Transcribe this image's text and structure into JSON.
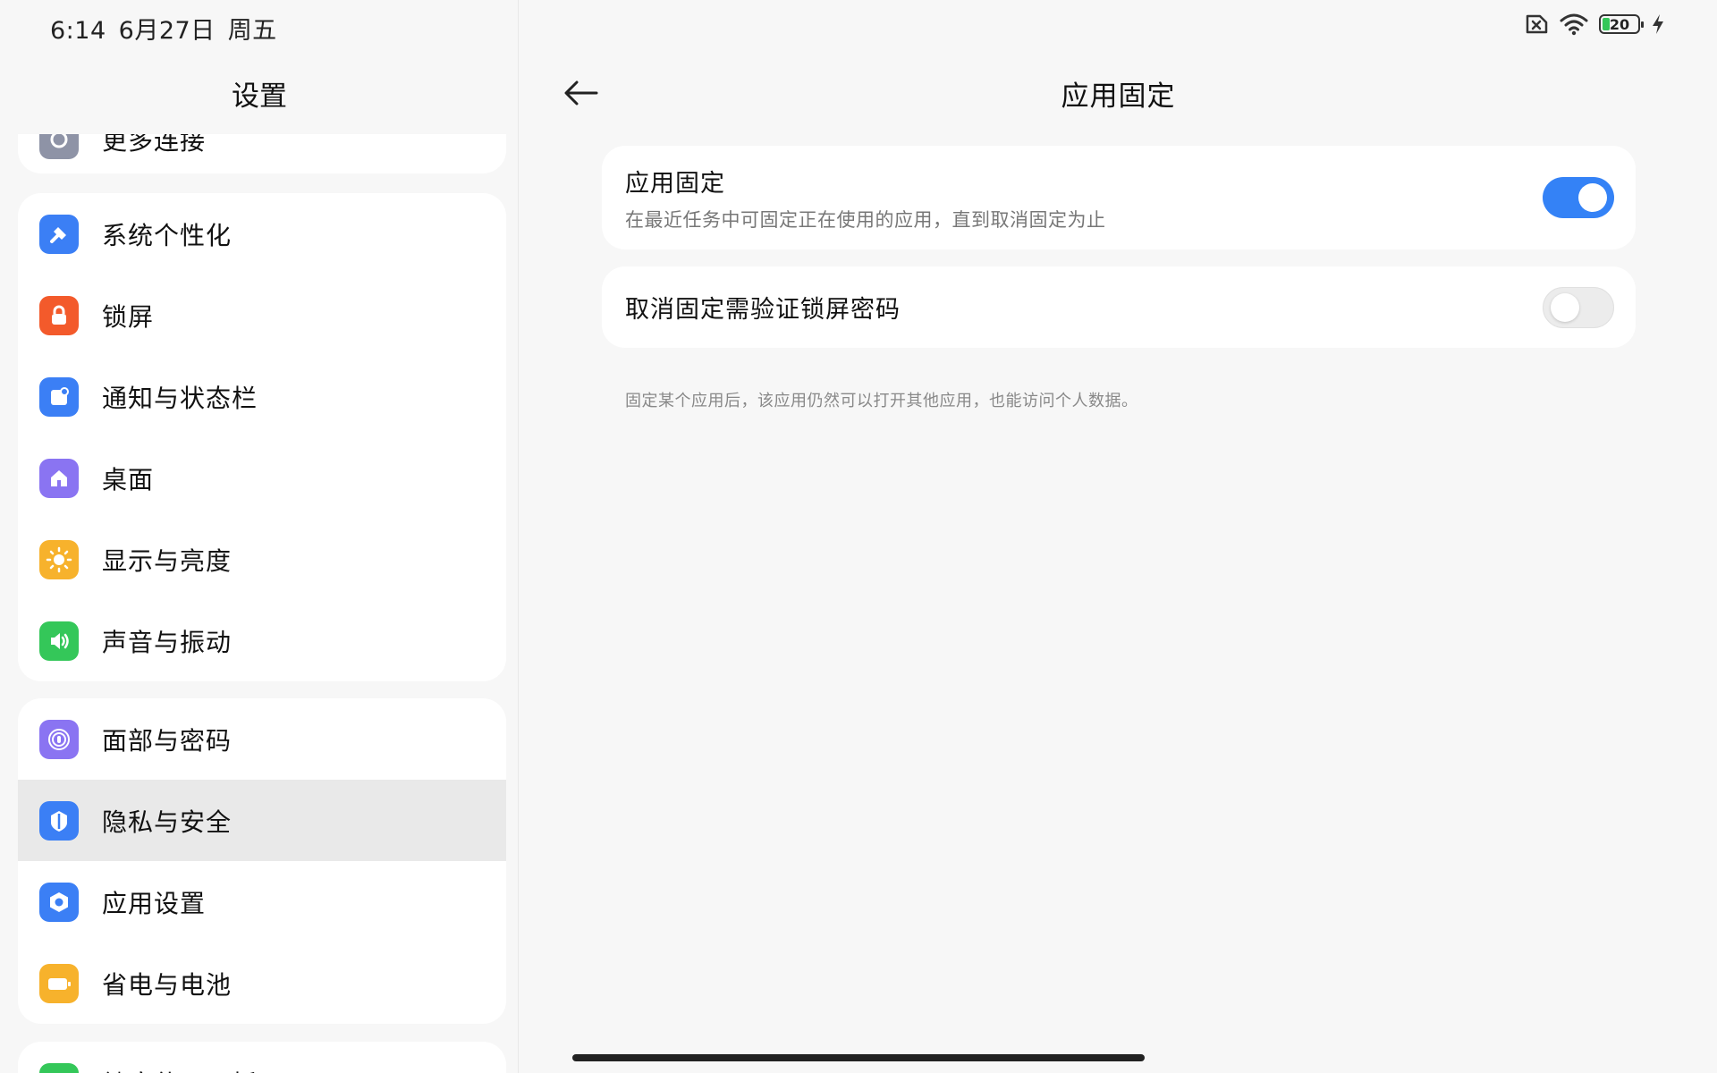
{
  "status_bar": {
    "time": "6:14",
    "date": "6月27日",
    "weekday": "周五",
    "battery_level": "20",
    "icons": [
      "no-sim-icon",
      "wifi-icon",
      "battery-icon",
      "charging-icon"
    ]
  },
  "sidebar": {
    "title": "设置",
    "partial_top_item": "更多连接",
    "groups": [
      {
        "items": [
          {
            "label": "系统个性化",
            "icon": "personalization-icon",
            "color": "#3b7ff5"
          },
          {
            "label": "锁屏",
            "icon": "lock-icon",
            "color": "#f35a2b"
          },
          {
            "label": "通知与状态栏",
            "icon": "notification-icon",
            "color": "#3b7ff5"
          },
          {
            "label": "桌面",
            "icon": "home-icon",
            "color": "#8a74f2"
          },
          {
            "label": "显示与亮度",
            "icon": "sun-icon",
            "color": "#f7b22c"
          },
          {
            "label": "声音与振动",
            "icon": "speaker-icon",
            "color": "#34c759"
          }
        ]
      },
      {
        "items": [
          {
            "label": "面部与密码",
            "icon": "face-password-icon",
            "color": "#8a74f2"
          },
          {
            "label": "隐私与安全",
            "icon": "privacy-shield-icon",
            "color": "#3b7ff5",
            "selected": true
          },
          {
            "label": "应用设置",
            "icon": "app-settings-icon",
            "color": "#3b7ff5"
          },
          {
            "label": "省电与电池",
            "icon": "battery-saver-icon",
            "color": "#f7b22c"
          }
        ]
      }
    ],
    "partial_bottom_item": "健康使用平板"
  },
  "detail": {
    "title": "应用固定",
    "settings": [
      {
        "title": "应用固定",
        "subtitle": "在最近任务中可固定正在使用的应用，直到取消固定为止",
        "enabled": true
      },
      {
        "title": "取消固定需验证锁屏密码",
        "enabled": false
      }
    ],
    "footnote": "固定某个应用后，该应用仍然可以打开其他应用，也能访问个人数据。"
  },
  "colors": {
    "accent": "#3482f6",
    "background": "#f7f7f7",
    "card": "#ffffff",
    "selected_row": "#e9e9e9"
  }
}
